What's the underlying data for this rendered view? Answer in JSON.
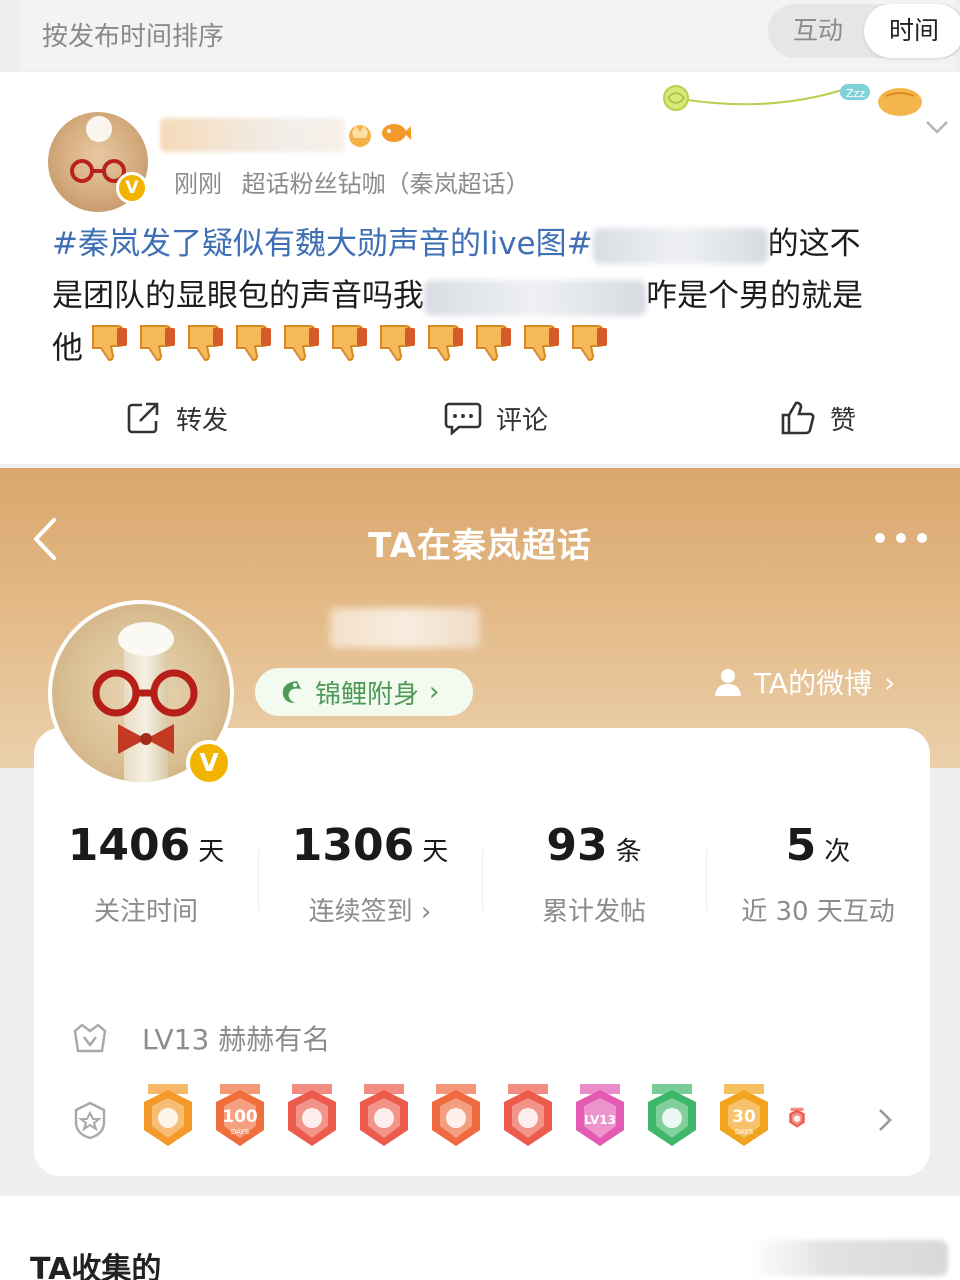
{
  "sort_bar": {
    "label": "按发布时间排序",
    "options": [
      "互动",
      "时间"
    ],
    "selected": "时间"
  },
  "post": {
    "meta": {
      "time": "刚刚",
      "source": "超话粉丝钻咖（秦岚超话）"
    },
    "content": {
      "topic": "#秦岚发了疑似有魏大勋声音的live图#",
      "line1_tail": "的这不",
      "line2_head": "是团队的显眼包的声音吗我",
      "line2_tail": "咋是个男的就是",
      "line3_head": "他",
      "thumbs_down_count": 11
    },
    "actions": {
      "repost": "转发",
      "comment": "评论",
      "like": "赞"
    }
  },
  "profile": {
    "title": "TA在秦岚超话",
    "koi_label": "锦鲤附身",
    "ta_weibo": "TA的微博",
    "stats": [
      {
        "value": "1406",
        "unit": "天",
        "label": "关注时间"
      },
      {
        "value": "1306",
        "unit": "天",
        "label": "连续签到 ›"
      },
      {
        "value": "93",
        "unit": "条",
        "label": "累计发帖"
      },
      {
        "value": "5",
        "unit": "次",
        "label": "近 30 天互动"
      }
    ],
    "level": "LV13 赫赫有名",
    "badges": [
      {
        "name": "crown-badge",
        "color": "#f39a2a"
      },
      {
        "name": "100-days-badge",
        "text": "100",
        "sub": "DAYS",
        "color": "#f06e3c"
      },
      {
        "name": "rabbit-badge-1",
        "color": "#ec5b4c"
      },
      {
        "name": "rabbit-badge-2",
        "color": "#ec5b4c"
      },
      {
        "name": "rabbit-badge-3",
        "color": "#ef6a3e"
      },
      {
        "name": "rabbit-badge-4",
        "color": "#ec5b4c"
      },
      {
        "name": "lv13-badge",
        "text": "LV13",
        "color": "#e35bb3"
      },
      {
        "name": "hand-badge",
        "color": "#3fb76a"
      },
      {
        "name": "30-days-badge",
        "text": "30",
        "sub": "DAYS",
        "color": "#f2a41e"
      },
      {
        "name": "partial-badge",
        "color": "#ec5b4c"
      }
    ]
  },
  "footer": {
    "section_title": "TA收集的"
  },
  "colors": {
    "topic_link": "#3f6fb4",
    "verified_badge": "#f3b400",
    "header_gold": "#d9a66d",
    "koi_green": "#4d9a55"
  }
}
